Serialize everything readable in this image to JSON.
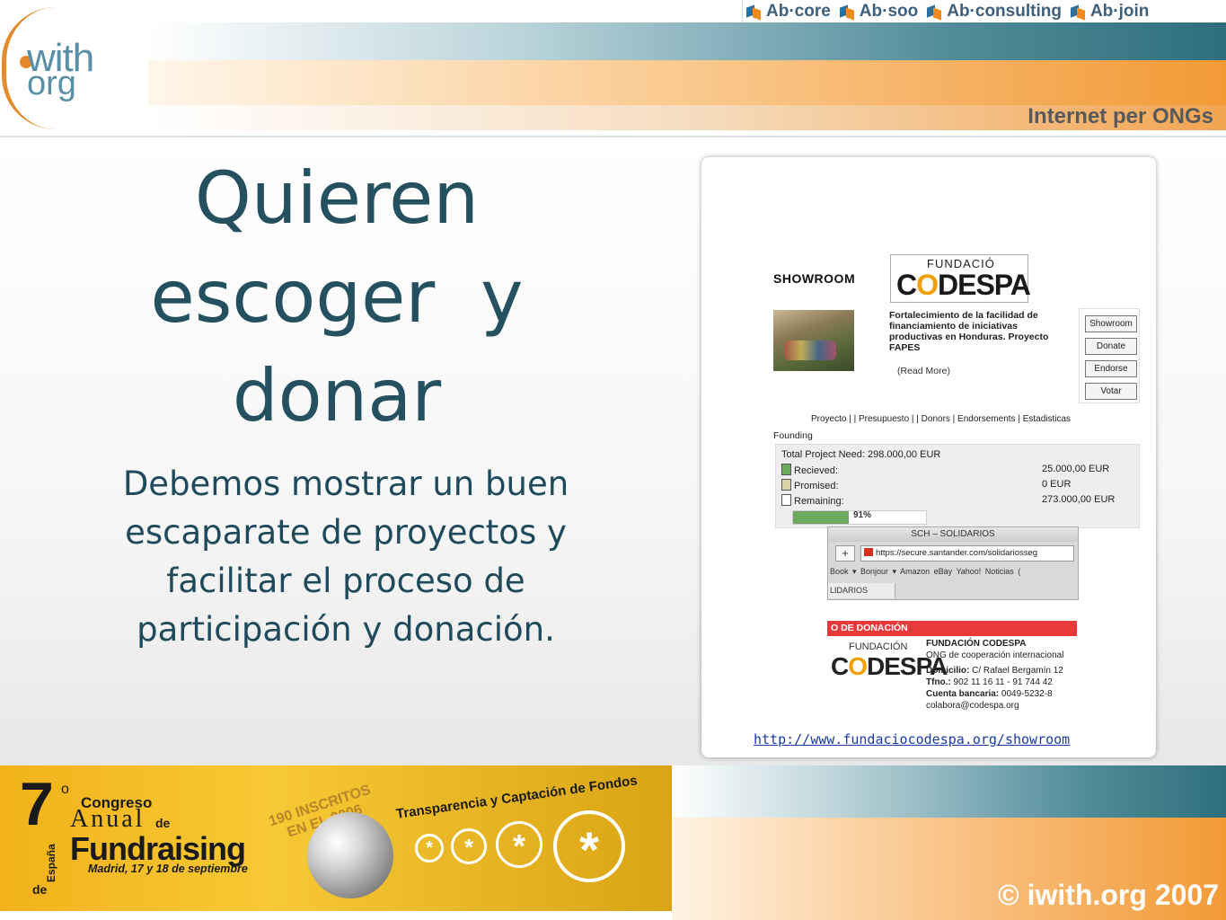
{
  "header": {
    "logo_text_top": "with",
    "logo_text_bottom": "org",
    "tagline": "Internet per ONGs",
    "nav": [
      "Ab·core",
      "Ab·soo",
      "Ab·consulting",
      "Ab·join"
    ]
  },
  "slide": {
    "title_lines": [
      "Quieren",
      "escoger  y",
      "donar"
    ],
    "body": "Debemos mostrar un buen escaparate de proyectos y facilitar el proceso de participación y donación."
  },
  "showroom": {
    "heading": "SHOWROOM",
    "logo_top": "FUNDACIÓ",
    "logo_name_pre": "C",
    "logo_name_o": "O",
    "logo_name_post": "DESPA",
    "project_desc": "Fortalecimiento de la facilidad de financiamiento de iniciativas productivas en Honduras. Proyecto FAPES",
    "read_more": "(Read More)",
    "buttons": [
      "Showroom",
      "Donate",
      "Endorse",
      "Votar"
    ],
    "tabs": "Proyecto | | Presupuesto | | Donors | Endorsements | Estadisticas",
    "founding_label": "Founding",
    "total_need": "Total Project Need: 298.000,00 EUR",
    "rows": [
      {
        "label": "Recieved:",
        "value": "25.000,00 EUR",
        "color": "#6cab5e"
      },
      {
        "label": "Promised:",
        "value": "0 EUR",
        "color": "#d8d2a4"
      },
      {
        "label": "Remaining:",
        "value": "273.000,00 EUR",
        "color": "#ffffff"
      }
    ],
    "progress_text": "91%",
    "progress_fraction": 0.42
  },
  "browser": {
    "title": "SCH – SOLIDARIOS",
    "url": "https://secure.santander.com/solidariosseg",
    "bookmarks": "Book ▾  Bonjour ▾  Amazon  eBay  Yahoo!  Noticias (",
    "tab": "LIDARIOS"
  },
  "donation": {
    "heading": "O DE DONACIÓN",
    "logo_top": "FUNDACIÓN",
    "logo_name_pre": "C",
    "logo_name_o": "O",
    "logo_name_post": "DESPA",
    "org_name": "FUNDACIÓN CODESPA",
    "org_sub": "ONG de cooperación internacional",
    "domicilio_label": "Domicilio:",
    "domicilio": "C/ Rafael Bergamín 12",
    "tfno_label": "Tfno.:",
    "tfno": "902 11 16 11 - 91 744 42",
    "cuenta_label": "Cuenta bancaria:",
    "cuenta": "0049-5232-8",
    "email": "colabora@codespa.org"
  },
  "link": "http://www.fundaciocodespa.org/showroom",
  "banner": {
    "num": "7",
    "ord": "o",
    "congreso": "Congreso",
    "anual": "Anual",
    "de": "de",
    "fundraising": "Fundraising",
    "dates": "Madrid, 17 y 18 de septiembre",
    "espana": "España",
    "de2": "de",
    "inscritos_1": "190 INSCRITOS",
    "inscritos_2": "EN EL 2006",
    "transparencia": "Transparencia y Captación de Fondos"
  },
  "footer": {
    "copyright": "© iwith.org 2007"
  },
  "colors": {
    "title": "#245060",
    "accent_orange": "#f29a36",
    "accent_teal": "#2f6f7d"
  }
}
